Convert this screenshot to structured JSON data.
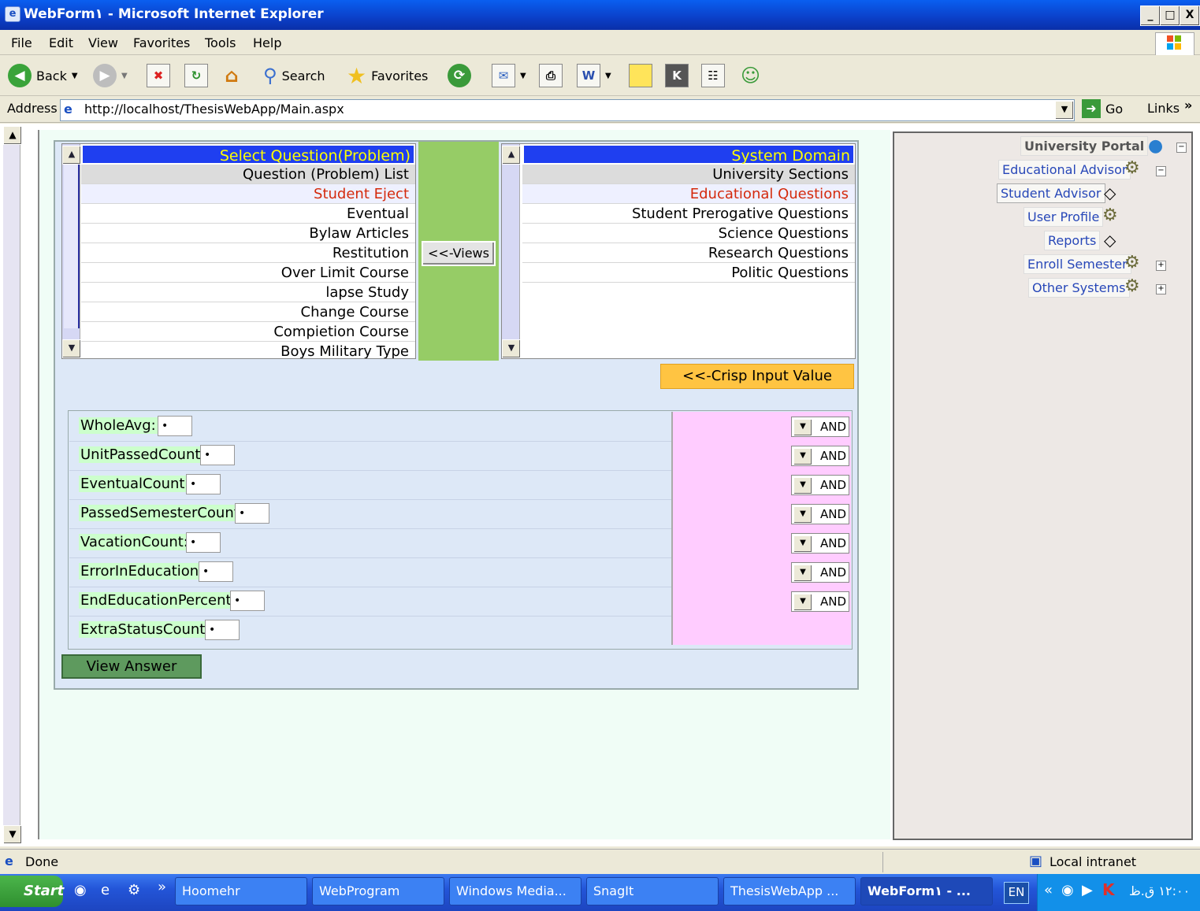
{
  "window": {
    "title": "WebForm١ - Microsoft Internet Explorer",
    "buttons": [
      "_",
      "□",
      "X"
    ]
  },
  "menu": [
    "File",
    "Edit",
    "View",
    "Favorites",
    "Tools",
    "Help"
  ],
  "toolbar": {
    "back": "Back",
    "search": "Search",
    "favorites": "Favorites"
  },
  "address": {
    "label": "Address",
    "url": "http://localhost/ThesisWebApp/Main.aspx",
    "go": "Go",
    "links": "Links"
  },
  "left_list": {
    "header": "Select Question(Problem)",
    "items": [
      "Question (Problem) List",
      "Student Eject",
      "Eventual",
      "Bylaw Articles",
      "Restitution",
      "Over Limit Course",
      "lapse Study",
      "Change Course",
      "Compietion Course",
      "Boys Military Type"
    ]
  },
  "views_button": "<<-Views",
  "right_list": {
    "header": "System Domain",
    "items": [
      "University Sections",
      "Educational Questions",
      "Student Prerogative Questions",
      "Science Questions",
      "Research Questions",
      "Politic Questions"
    ]
  },
  "crisp_button": "<<-Crisp Input Value",
  "fields": [
    {
      "label": "WholeAvg:",
      "value": "•",
      "op": "AND"
    },
    {
      "label": "UnitPassedCount:",
      "value": "•",
      "op": "AND"
    },
    {
      "label": "EventualCount:",
      "value": "•",
      "op": "AND"
    },
    {
      "label": "PassedSemesterCount:",
      "value": "•",
      "op": "AND"
    },
    {
      "label": "VacationCount:",
      "value": "•",
      "op": "AND"
    },
    {
      "label": "ErrorInEducation:",
      "value": "•",
      "op": "AND"
    },
    {
      "label": "EndEducationPercent:",
      "value": "•",
      "op": "AND"
    },
    {
      "label": "ExtraStatusCount:",
      "value": "•",
      "op": ""
    }
  ],
  "view_answer": "View Answer",
  "tree": {
    "root": "University Portal",
    "items": [
      "Educational Advisor",
      "Student Advisor",
      "User Profile",
      "Reports",
      "Enroll Semester",
      "Other Systems"
    ]
  },
  "status": {
    "text": "Done",
    "zone": "Local intranet"
  },
  "taskbar": {
    "start": "Start",
    "tasks": [
      "Hoomehr",
      "WebProgram",
      "Windows Media...",
      "SnagIt",
      "ThesisWebApp ...",
      "WebForm١ - ..."
    ],
    "lang": "EN",
    "clock": "١٢:٠٠ ق.ظ"
  }
}
